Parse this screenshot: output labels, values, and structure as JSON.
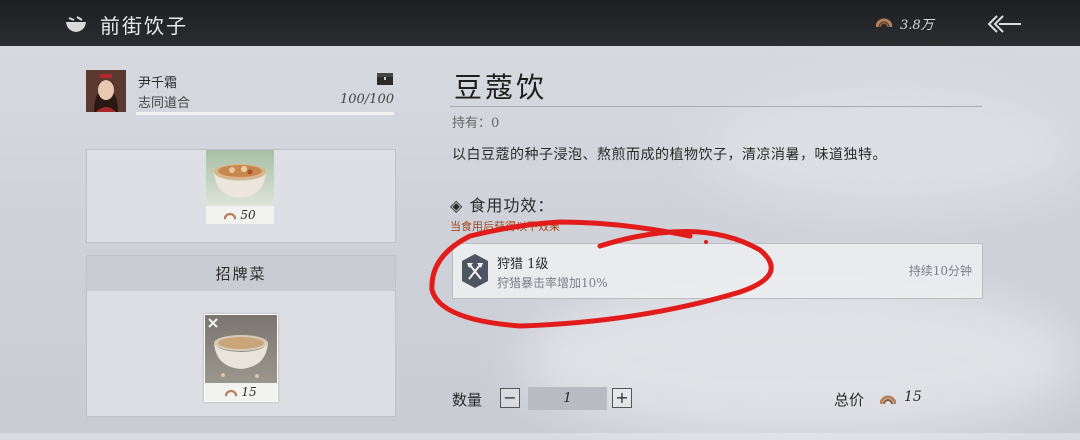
{
  "header": {
    "title": "前街饮子",
    "money": "3.8万"
  },
  "character": {
    "name": "尹千霜",
    "relation": "志同道合",
    "affinity": "100/100"
  },
  "shop": {
    "dish_price": "50",
    "signature_title": "招牌菜",
    "signature_price": "15"
  },
  "item": {
    "name": "豆蔻饮",
    "held": "持有：0",
    "description": "以白豆蔻的种子浸泡、熬煎而成的植物饮子，清凉消暑，味道独特。",
    "effect_title": "◈ 食用功效：",
    "effect_subtitle": "当食用后获得以下效果",
    "effect": {
      "name": "狩猎 1级",
      "desc": "狩猎暴击率增加10%",
      "duration": "持续10分钟"
    }
  },
  "purchase": {
    "qty_label": "数量",
    "minus": "−",
    "plus": "+",
    "quantity": "1",
    "total_label": "总价",
    "total": "15"
  },
  "icons": [
    "bowl-icon",
    "coin-icon",
    "back-arrow-icon",
    "chest-icon",
    "hunting-axes-icon"
  ],
  "colors": {
    "topbar": "#1d1f22",
    "accent_red": "#e21b1b",
    "effect_subtitle": "#a3451a"
  }
}
